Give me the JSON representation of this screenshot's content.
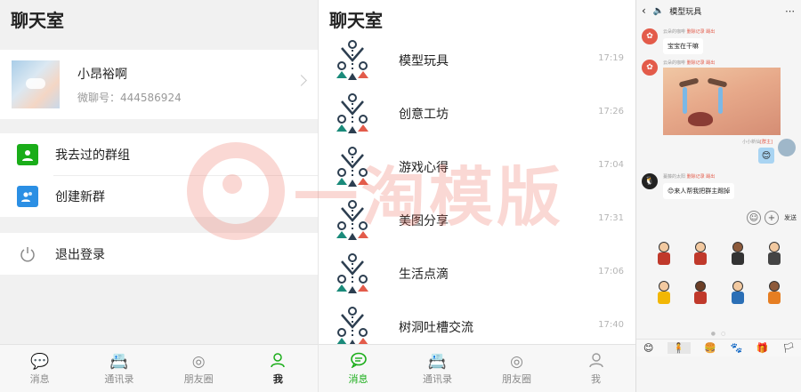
{
  "panel1": {
    "title": "聊天室",
    "profile": {
      "name": "小昂裕啊",
      "id": "微聊号：444586924"
    },
    "menu": [
      {
        "label": "我去过的群组",
        "icon": "group-history-icon"
      },
      {
        "label": "创建新群",
        "icon": "create-group-icon"
      }
    ],
    "logout": {
      "label": "退出登录",
      "icon": "power-icon"
    },
    "tabs": [
      {
        "label": "消息",
        "icon": "chat-bubble-icon"
      },
      {
        "label": "通讯录",
        "icon": "contacts-icon"
      },
      {
        "label": "朋友圈",
        "icon": "moments-icon"
      },
      {
        "label": "我",
        "icon": "person-icon"
      }
    ]
  },
  "panel2": {
    "title": "聊天室",
    "groups": [
      {
        "name": "模型玩具",
        "time": "17:19"
      },
      {
        "name": "创意工坊",
        "time": "17:26"
      },
      {
        "name": "游戏心得",
        "time": "17:04"
      },
      {
        "name": "美图分享",
        "time": "17:31"
      },
      {
        "name": "生活点滴",
        "time": "17:06"
      },
      {
        "name": "树洞吐槽交流",
        "time": "17:40"
      }
    ],
    "tabs": [
      {
        "label": "消息",
        "icon": "chat-bubble-icon"
      },
      {
        "label": "通讯录",
        "icon": "contacts-icon"
      },
      {
        "label": "朋友圈",
        "icon": "moments-icon"
      },
      {
        "label": "我",
        "icon": "person-icon"
      }
    ]
  },
  "panel3": {
    "title": "模型玩具",
    "messages": [
      {
        "sender": "云朵的咖啡",
        "actions": "删除记录 踢出",
        "text": "宝宝在干嘛"
      },
      {
        "sender": "云朵的咖啡",
        "actions": "删除记录 踢出",
        "image": "crying-baby"
      },
      {
        "sender": "小小新仙",
        "tag": "[群主]",
        "emoji": "😊"
      },
      {
        "sender": "蔓藤的太阳",
        "actions": "删除记录 踢出",
        "text": "😊来人帮我把群主踢掉"
      }
    ],
    "send_label": "发送",
    "emoji_bar": [
      "😊",
      "🧍",
      "🍔",
      "🐾",
      "🎁",
      "🏳"
    ]
  },
  "watermark": {
    "text": "一淘模版"
  },
  "colors": {
    "accent": "#1aad19",
    "blue": "#2b8fe4",
    "red": "#e35b4a"
  }
}
